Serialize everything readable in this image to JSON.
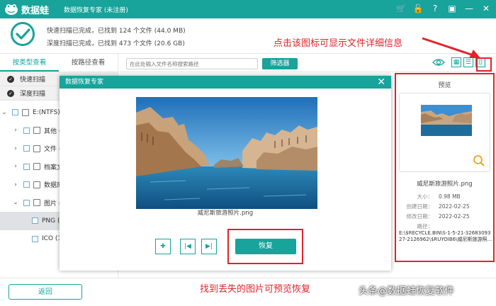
{
  "app": {
    "brand": "数据蛙",
    "window_title": "数据恢复专家 (未注册)"
  },
  "titlebar_icons": [
    "cart-icon",
    "unlock-icon",
    "help-icon",
    "feedback-icon",
    "minimize-icon",
    "close-icon"
  ],
  "status": {
    "quick_scan": "快速扫描已完成，已找到 124 个文件 (44.0 MB)",
    "deep_scan": "深度扫描已完成，已找到 473 个文件 (20.6 GB)"
  },
  "annotations": {
    "top_callout": "点击该图标可显示文件详细信息",
    "bottom_callout": "找到丢失的图片可预览恢复"
  },
  "tabs": [
    {
      "label": "按类型查看",
      "active": true
    },
    {
      "label": "按路径查看",
      "active": false
    }
  ],
  "scan_items": [
    "快速扫描",
    "深度扫描"
  ],
  "tree": [
    {
      "label": "E:(NTFS) (",
      "arrow": "v",
      "indent": 0,
      "icon": "drive-icon"
    },
    {
      "label": "其他 (",
      "arrow": ">",
      "indent": 1,
      "icon": "folder-icon"
    },
    {
      "label": "文件 (",
      "arrow": ">",
      "indent": 1,
      "icon": "document-icon"
    },
    {
      "label": "档案文",
      "arrow": ">",
      "indent": 1,
      "icon": "archive-icon"
    },
    {
      "label": "数据库",
      "arrow": ">",
      "indent": 1,
      "icon": "database-icon"
    },
    {
      "label": "图片 (2",
      "arrow": "v",
      "indent": 1,
      "icon": "image-icon"
    },
    {
      "label": "PNG (",
      "arrow": "",
      "indent": 2,
      "icon": "",
      "selected": true
    },
    {
      "label": "ICO (1",
      "arrow": "",
      "indent": 2,
      "icon": ""
    }
  ],
  "search": {
    "placeholder": "在此处输入文件名称搜索路径"
  },
  "filter_label": "筛选器",
  "view_icons": [
    "eye-icon",
    "grid-view-icon",
    "list-view-icon",
    "detail-view-icon"
  ],
  "preview_panel": {
    "title": "预览",
    "file_name": "威尼斯旅游照片.png",
    "size_label": "大小：",
    "size_value": "0.98 MB",
    "created_label": "创建日期：",
    "created_value": "2022-02-25",
    "modified_label": "修改日期：",
    "modified_value": "2022-02-25",
    "path_label": "路径：",
    "path_value": "E:\\$RECYCLE.BIN\\S-1-5-21-3268309327-2126962\\$RUYOIB6\\威尼斯旅游照..."
  },
  "dialog": {
    "title": "数据恢复专家",
    "file_name": "威尼斯旅游照片.png",
    "recover_label": "恢复"
  },
  "back_label": "返回",
  "watermark": "头条@数据蛙恢复软件",
  "colors": {
    "accent": "#18a39b",
    "highlight": "#e0242b"
  }
}
